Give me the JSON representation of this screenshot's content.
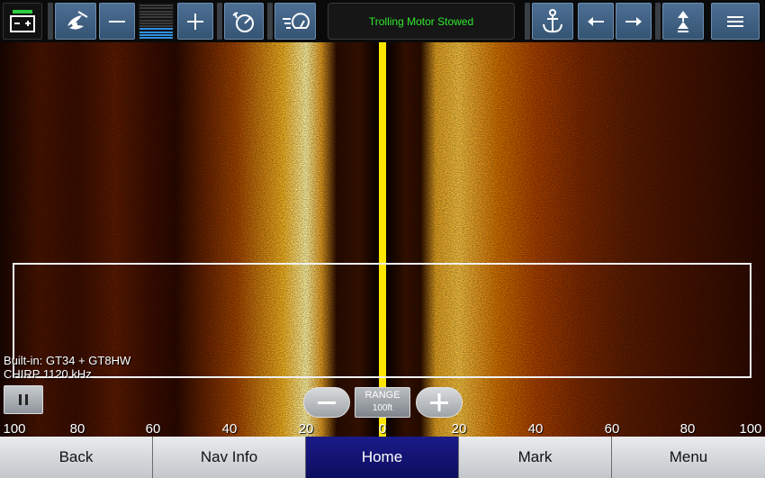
{
  "status": {
    "message": "Trolling Motor Stowed"
  },
  "toolbar": {
    "battery_icon": "battery-icon",
    "motor_icon": "propeller-icon",
    "speed_decrease_icon": "minus-icon",
    "speed_level_fraction": 0.35,
    "speed_increase_icon": "plus-icon",
    "cruise_icon": "speedometer-icon",
    "autopilot_icon": "speed-lines-icon",
    "anchor_icon": "anchor-icon",
    "left_icon": "arrow-left-icon",
    "right_icon": "arrow-right-icon",
    "jog_icon": "jog-up-icon",
    "menu_icon": "hamburger-icon"
  },
  "sonar": {
    "transducer_line1": "Built-in: GT34 + GT8HW",
    "transducer_line2": "CHIRP 1120 kHz",
    "range_label": "RANGE",
    "range_value": "100ft",
    "scale_labels": [
      "100",
      "80",
      "60",
      "40",
      "20",
      "0",
      "20",
      "40",
      "60",
      "80",
      "100"
    ]
  },
  "bottom_nav": [
    {
      "label": "Back",
      "active": false
    },
    {
      "label": "Nav Info",
      "active": false
    },
    {
      "label": "Home",
      "active": true
    },
    {
      "label": "Mark",
      "active": false
    },
    {
      "label": "Menu",
      "active": false
    }
  ],
  "colors": {
    "active_nav": "#0d0d5e",
    "status_text": "#2ee82e",
    "center_line": "#ffe600"
  }
}
